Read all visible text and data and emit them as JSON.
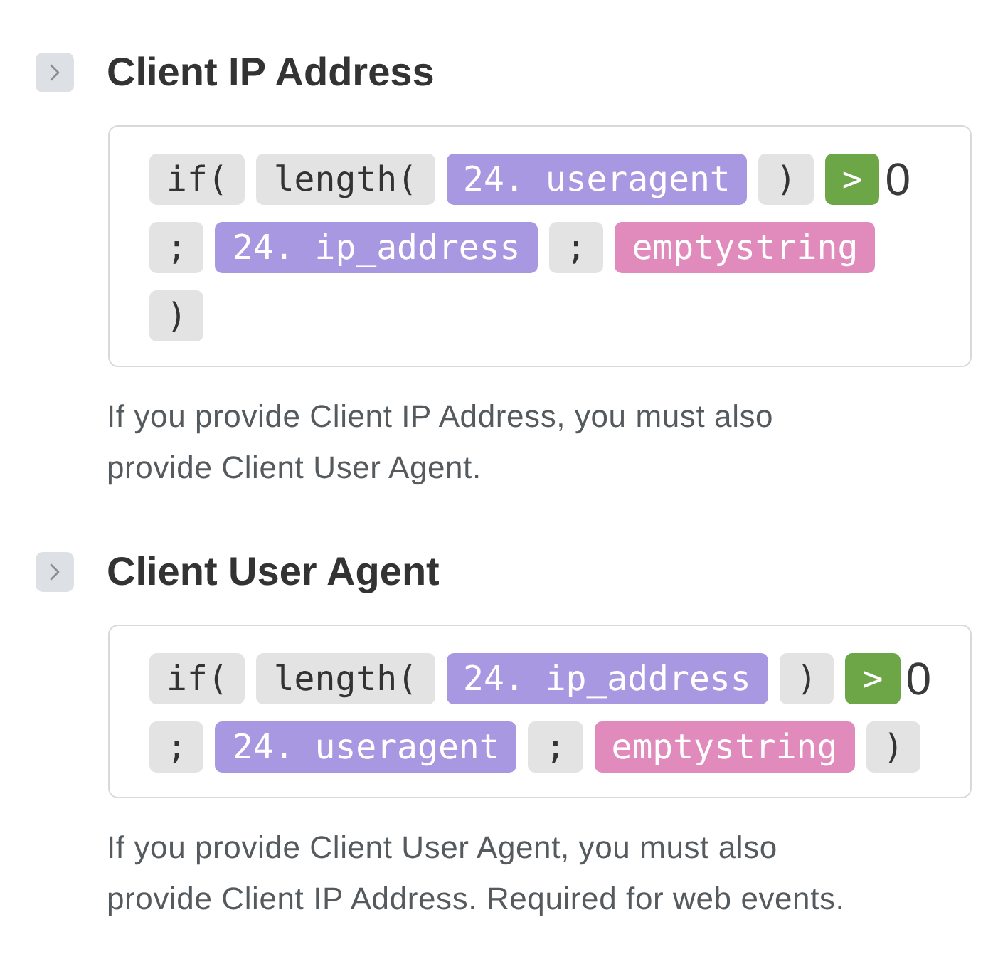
{
  "sections": [
    {
      "title": "Client IP Address",
      "formula": [
        {
          "kind": "syntax",
          "text": "if("
        },
        {
          "kind": "syntax",
          "text": "length("
        },
        {
          "kind": "field",
          "text": "24. useragent"
        },
        {
          "kind": "syntax",
          "text": ")"
        },
        {
          "kind": "operator",
          "text": ">"
        },
        {
          "kind": "number",
          "text": "0"
        },
        {
          "kind": "syntax",
          "text": ";"
        },
        {
          "kind": "field",
          "text": "24. ip_address"
        },
        {
          "kind": "syntax",
          "text": ";"
        },
        {
          "kind": "constant",
          "text": "emptystring"
        },
        {
          "kind": "syntax",
          "text": ")"
        }
      ],
      "description": "If you provide Client IP Address, you must also provide Client User Agent."
    },
    {
      "title": "Client User Agent",
      "formula": [
        {
          "kind": "syntax",
          "text": "if("
        },
        {
          "kind": "syntax",
          "text": "length("
        },
        {
          "kind": "field",
          "text": "24. ip_address"
        },
        {
          "kind": "syntax",
          "text": ")"
        },
        {
          "kind": "operator",
          "text": ">"
        },
        {
          "kind": "number",
          "text": "0"
        },
        {
          "kind": "syntax",
          "text": ";"
        },
        {
          "kind": "field",
          "text": "24. useragent"
        },
        {
          "kind": "syntax",
          "text": ";"
        },
        {
          "kind": "constant",
          "text": "emptystring"
        },
        {
          "kind": "syntax",
          "text": ")"
        }
      ],
      "description": "If you provide Client User Agent, you must also provide Client IP Address. Required for web events."
    }
  ]
}
